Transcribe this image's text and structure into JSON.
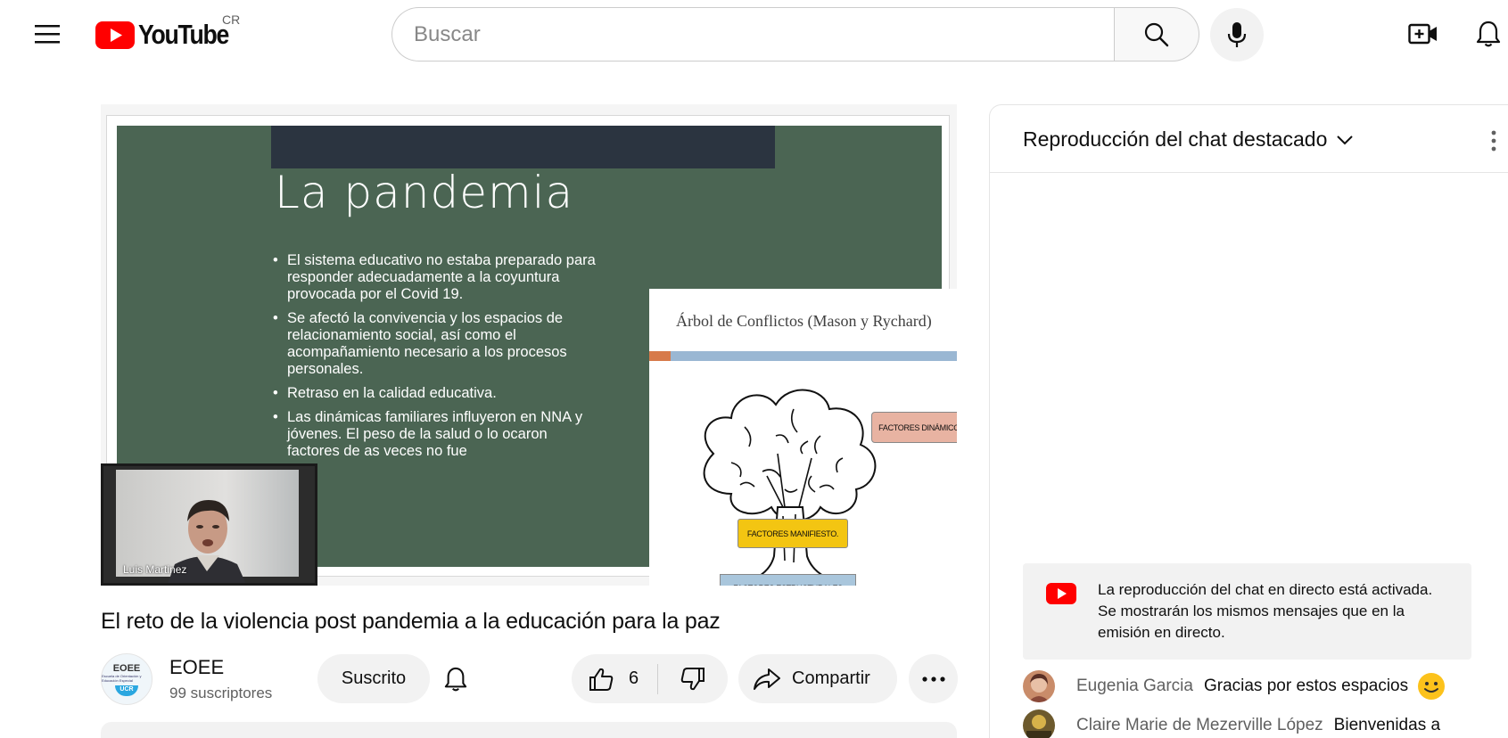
{
  "masthead": {
    "logo_text": "YouTube",
    "region": "CR",
    "search_placeholder": "Buscar",
    "icons": [
      "menu-icon",
      "youtube-logo-icon",
      "search-icon",
      "mic-icon",
      "create-video-icon",
      "bell-icon"
    ]
  },
  "player": {
    "slide": {
      "title": "La pandemia",
      "bullets": [
        "El sistema educativo no estaba preparado para responder adecuadamente a la coyuntura provocada por el Covid 19.",
        "Se afectó la convivencia y los espacios de relacionamiento social, así como el acompañamiento necesario a los procesos personales.",
        "Retraso en la calidad educativa.",
        "Las dinámicas familiares influyeron en NNA y jóvenes. El peso de la salud o lo ocaron factores de as veces no fue"
      ],
      "card_title": "Árbol de Conflictos (Mason y Rychard)",
      "labels": {
        "dynamic": "FACTORES DINÁMICOS.",
        "manifest": "FACTORES MANIFIESTO.",
        "structural": "FACTORES ESTRUCTURALES"
      }
    },
    "speaker_name": "Luis Martinez"
  },
  "video": {
    "title": "El reto de la violencia post pandemia a la educación para la paz",
    "channel": {
      "name": "EOEE",
      "subscribers": "99 suscriptores",
      "avatar_text": "EOEE",
      "avatar_sub": "Escuela de Orientación y Educación Especial",
      "avatar_badge": "UCR"
    },
    "subscribe_label": "Suscrito",
    "like_count": "6",
    "share_label": "Compartir"
  },
  "chat": {
    "title": "Reproducción del chat destacado",
    "banner": "La reproducción del chat en directo está activada. Se mostrarán los mismos mensajes que en la emisión en directo.",
    "messages": [
      {
        "author": "Eugenia Garcia",
        "text": "Gracias por estos espacios",
        "emoji": "slightly-smiling-face"
      },
      {
        "author": "Claire Marie de Mezerville López",
        "text": "Bienvenidas a"
      }
    ]
  },
  "colors": {
    "youtube_red": "#ff0000",
    "slide_green": "#4b6553",
    "secondary_text": "#606060",
    "chip_bg": "#f2f2f2"
  }
}
